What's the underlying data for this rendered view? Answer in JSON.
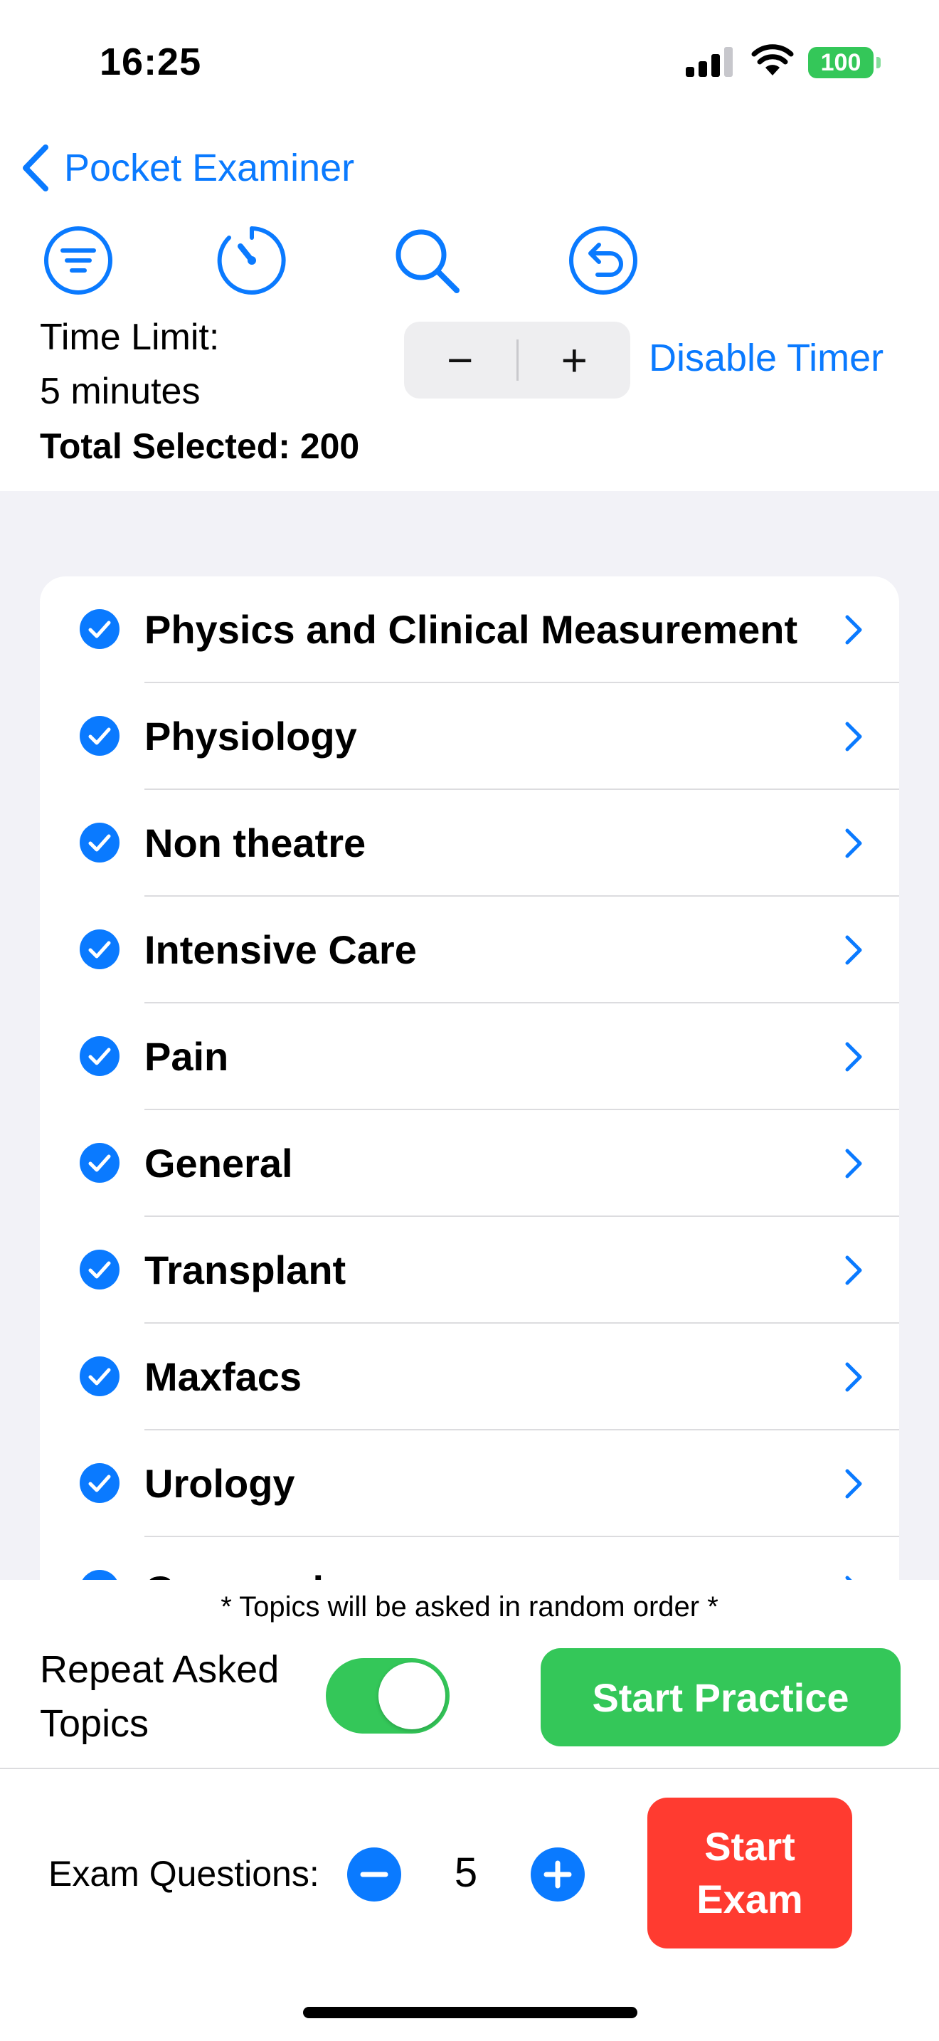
{
  "status_bar": {
    "time": "16:25",
    "battery": "100"
  },
  "nav": {
    "back_label": "Pocket Examiner"
  },
  "toolbar": {
    "icons": [
      "filter-icon",
      "timer-icon",
      "search-icon",
      "reset-icon"
    ]
  },
  "timer": {
    "label_line1": "Time Limit:",
    "label_line2": "5 minutes",
    "decrement": "−",
    "increment": "+",
    "disable_label": "Disable Timer"
  },
  "total_selected": "Total Selected: 200",
  "topics": [
    {
      "label": "Physics and Clinical Measurement",
      "checked": true
    },
    {
      "label": "Physiology",
      "checked": true
    },
    {
      "label": "Non theatre",
      "checked": true
    },
    {
      "label": "Intensive Care",
      "checked": true
    },
    {
      "label": "Pain",
      "checked": true
    },
    {
      "label": "General",
      "checked": true
    },
    {
      "label": "Transplant",
      "checked": true
    },
    {
      "label": "Maxfacs",
      "checked": true
    },
    {
      "label": "Urology",
      "checked": true
    },
    {
      "label": "Gynaecology",
      "checked": true
    }
  ],
  "practice": {
    "random_note": "* Topics will be asked in random order *",
    "repeat_line1": "Repeat Asked",
    "repeat_line2": "Topics",
    "repeat_on": true,
    "start_label": "Start Practice"
  },
  "exam": {
    "questions_label": "Exam Questions:",
    "count": "5",
    "start_line1": "Start",
    "start_line2": "Exam"
  },
  "colors": {
    "accent": "#0a7aff",
    "green": "#34c759",
    "red": "#ff3b30",
    "background": "#f2f2f7"
  }
}
